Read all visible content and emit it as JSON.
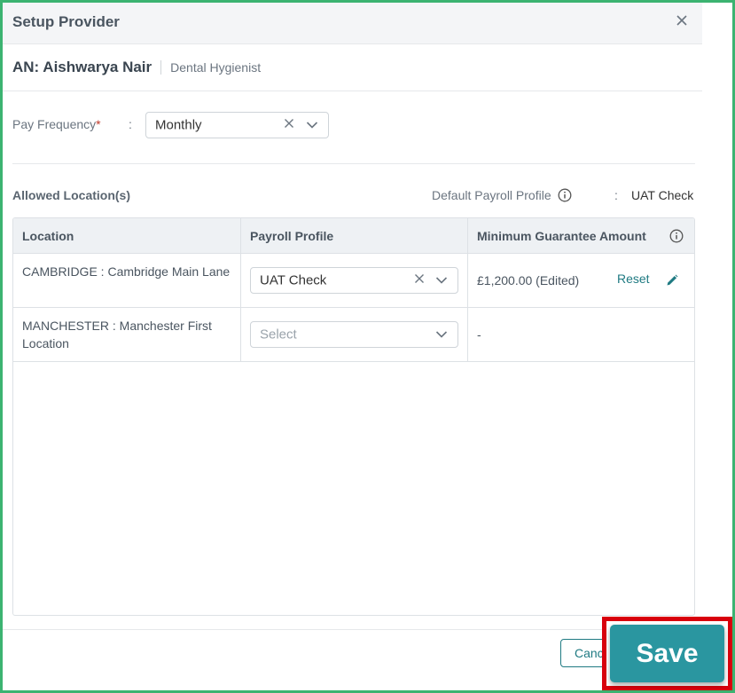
{
  "header": {
    "title": "Setup Provider",
    "close_icon": "close-icon"
  },
  "provider": {
    "name": "AN: Aishwarya Nair",
    "role": "Dental Hygienist"
  },
  "pay_frequency": {
    "label": "Pay Frequency",
    "required_mark": "*",
    "colon": ":",
    "value": "Monthly"
  },
  "allowed_locations": {
    "title": "Allowed Location(s)",
    "default_payroll_label": "Default Payroll Profile",
    "colon": ":",
    "default_payroll_value": "UAT Check"
  },
  "table": {
    "columns": [
      "Location",
      "Payroll Profile",
      "Minimum Guarantee Amount"
    ],
    "rows": [
      {
        "location": "CAMBRIDGE : Cambridge Main Lane",
        "payroll_profile": "UAT Check",
        "payroll_placeholder": "",
        "amount": "£1,200.00 (Edited)",
        "reset": "Reset"
      },
      {
        "location": "MANCHESTER : Manchester First Location",
        "payroll_profile": "",
        "payroll_placeholder": "Select",
        "amount": "-",
        "reset": ""
      }
    ]
  },
  "footer": {
    "cancel_label": "Cancel",
    "save_label": "Save"
  },
  "colors": {
    "accent": "#2a96a0",
    "highlight": "#d8000c",
    "frame": "#3cb371",
    "required": "#c0392b"
  }
}
